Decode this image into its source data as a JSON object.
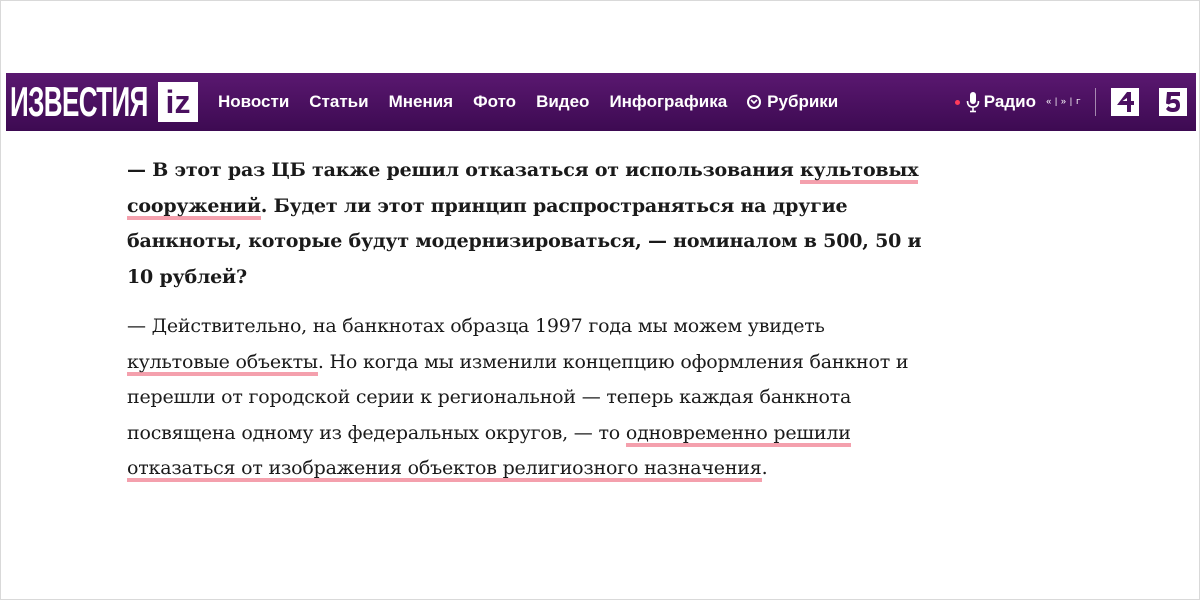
{
  "header": {
    "logo_text": "ИЗВЕСТИЯ",
    "logo_badge": "iz",
    "nav": [
      "Новости",
      "Статьи",
      "Мнения",
      "Фото",
      "Видео",
      "Инфографика"
    ],
    "rubrics_label": "Рубрики",
    "radio_label": "Радио",
    "wave_glyphs": [
      "«",
      "|",
      "»",
      "|",
      "г"
    ],
    "channel_icons": [
      "channel-4-icon",
      "channel-5-icon"
    ],
    "brand_color": "#4b1060"
  },
  "article": {
    "question": {
      "p1": "— В этот раз ЦБ также решил отказаться от использования ",
      "hl1": "культовых сооружений",
      "p2": ". Будет ли этот принцип распространяться на другие банкноты, которые будут модернизироваться, — номиналом в 500, 50 и 10 рублей?"
    },
    "answer": {
      "p1": "— Действительно, на банкнотах образца 1997 года мы можем увидеть ",
      "hl1": "культовые объекты",
      "p2": ". Но когда мы изменили концепцию оформления банкнот и перешли от городской серии к региональной — теперь каждая банкнота посвящена одному из федеральных округов, — то ",
      "hl2": "одновременно решили отказаться от изображения объектов религиозного назначения",
      "p3": "."
    },
    "highlight_color": "#f4a0ad"
  }
}
